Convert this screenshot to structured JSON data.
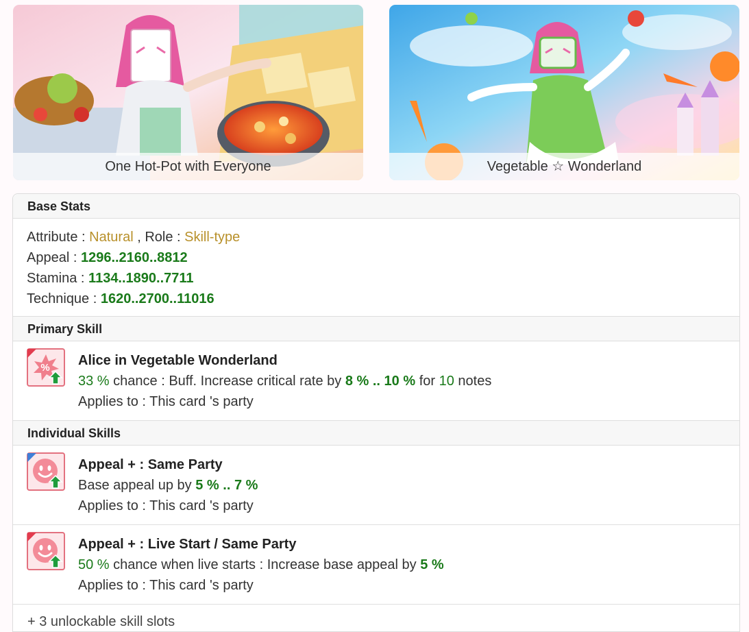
{
  "cards": [
    {
      "title": "One Hot-Pot with Everyone"
    },
    {
      "title": "Vegetable ☆ Wonderland"
    }
  ],
  "base_stats": {
    "heading": "Base Stats",
    "attribute_label": "Attribute :",
    "attribute_value": "Natural",
    "role_label": ", Role :",
    "role_value": "Skill-type",
    "appeal_label": "Appeal :",
    "appeal_value": "1296..2160..8812",
    "stamina_label": "Stamina :",
    "stamina_value": "1134..1890..7711",
    "technique_label": "Technique :",
    "technique_value": "1620..2700..11016"
  },
  "primary_skill": {
    "heading": "Primary Skill",
    "name": "Alice in Vegetable Wonderland",
    "chance": "33 %",
    "desc_a": "chance : Buff. Increase critical rate by",
    "range": "8 % .. 10 %",
    "desc_b": "for",
    "notes_count": "10",
    "desc_c": "notes",
    "applies": "Applies to : This card 's party"
  },
  "individual_skills": {
    "heading": "Individual Skills",
    "items": [
      {
        "name": "Appeal + : Same Party",
        "desc_a": "Base appeal up by",
        "value": "5 % .. 7 %",
        "applies": "Applies to : This card 's party"
      },
      {
        "name": "Appeal + : Live Start / Same Party",
        "chance": "50 %",
        "desc_a": "chance when live starts : Increase base appeal by",
        "value": "5 %",
        "applies": "Applies to : This card 's party"
      }
    ],
    "footer": "+ 3 unlockable skill slots"
  },
  "colors": {
    "attribute_gold": "#b8902a",
    "value_green": "#1a7a1a",
    "icon_pink": "#f08a96"
  }
}
